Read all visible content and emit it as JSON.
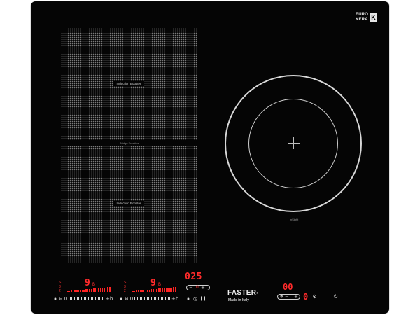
{
  "brand_badge": {
    "line1": "EURO",
    "line2": "KERA",
    "mark": "K"
  },
  "zones": {
    "top_label": "Induction Booster",
    "bottom_label": "Induction Booster",
    "bridge_label": "Bridge Function",
    "round_label": "InSight"
  },
  "control_panel": {
    "left": {
      "levels": [
        "S",
        "3",
        "2"
      ],
      "power_display": "9",
      "power_suffix": "B",
      "start_icon": "0",
      "end_icon": "+b"
    },
    "middle": {
      "levels": [
        "S",
        "3",
        "2"
      ],
      "power_display": "9",
      "power_suffix": "B",
      "start_icon": "0",
      "end_icon": "+b"
    },
    "timer": {
      "display": "025",
      "minus": "−",
      "plus": "+",
      "sub_display": "0"
    },
    "brand": {
      "name": "FASTER",
      "mark": "®",
      "tagline": "Made in Italy"
    },
    "right": {
      "display": "00",
      "minus": "−",
      "plus": "+",
      "level_display": "0"
    }
  },
  "icons": {
    "lock": "lock-icon",
    "pause": "pause-icon",
    "timer": "clock-icon",
    "power": "power-icon",
    "booster": "booster-icon"
  }
}
